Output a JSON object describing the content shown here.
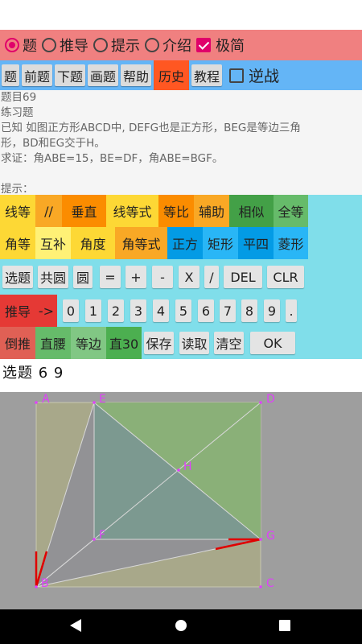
{
  "modebar": {
    "items": [
      {
        "label": "题",
        "type": "radio",
        "checked": true
      },
      {
        "label": "推导",
        "type": "radio",
        "checked": false
      },
      {
        "label": "提示",
        "type": "radio",
        "checked": false
      },
      {
        "label": "介绍",
        "type": "radio",
        "checked": false
      },
      {
        "label": "极简",
        "type": "checkbox",
        "checked": true
      }
    ]
  },
  "navbar": {
    "buttons": [
      "题",
      "前题",
      "下题",
      "画题",
      "帮助",
      "历史",
      "教程"
    ],
    "active": "历史",
    "checkbox_label": "逆战",
    "checkbox_checked": false
  },
  "problem": {
    "lines": [
      "题目69",
      "练习题",
      "已知 如图正方形ABCD中, DEFG也是正方形，BEG是等边三角",
      "形，BD和EG交于H。",
      "求证：角ABE=15，BE=DF，角ABE=BGF。",
      "",
      "提示："
    ]
  },
  "grid": {
    "row1": [
      "线等",
      "//",
      "垂直",
      "线等式",
      "等比",
      "辅助",
      "相似",
      "全等"
    ],
    "row2": [
      "角等",
      "互补",
      "角度",
      "角等式",
      "正方",
      "矩形",
      "平四",
      "菱形"
    ],
    "row3": [
      "选题",
      "共圆",
      "圆",
      "=",
      "+",
      "-",
      "X",
      "/",
      "DEL",
      "CLR"
    ],
    "row4": [
      "推导",
      "->",
      "0",
      "1",
      "2",
      "3",
      "4",
      "5",
      "6",
      "7",
      "8",
      "9",
      "."
    ],
    "row5": [
      "倒推",
      "直腰",
      "等边",
      "直30",
      "保存",
      "读取",
      "清空",
      "OK"
    ]
  },
  "output": {
    "text": "选题 6 9"
  },
  "figure": {
    "points": {
      "A": "A",
      "B": "B",
      "C": "C",
      "D": "D",
      "E": "E",
      "F": "F",
      "G": "G",
      "H": "H"
    }
  },
  "colors": {
    "modebar": "#f08080",
    "navbar": "#64b5f6",
    "active": "#ff5722",
    "grid": "#80deea",
    "point_label": "#e040fb",
    "mark": "#e00000"
  },
  "icons": {
    "back": "back-triangle-icon",
    "home": "home-circle-icon",
    "recents": "recents-square-icon"
  }
}
